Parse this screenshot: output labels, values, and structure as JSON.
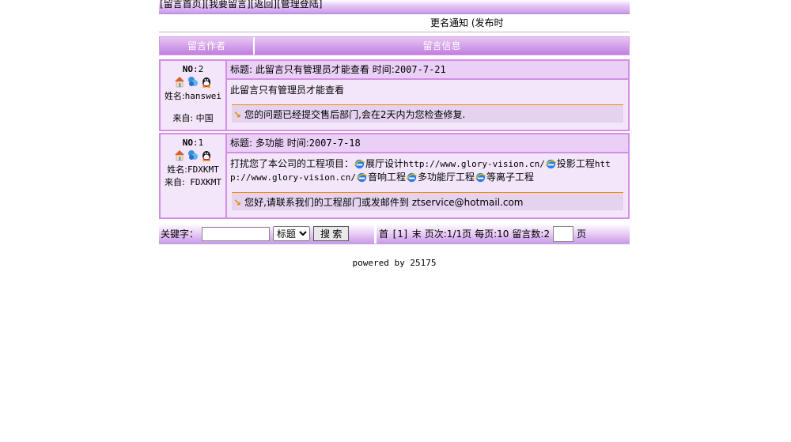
{
  "nav": {
    "items": [
      "[留言首页]",
      "[我要留言]",
      "[返回]",
      "[管理登陆]"
    ]
  },
  "notice": "更名通知 (发布时",
  "header": {
    "author": "留言作者",
    "info": "留言信息"
  },
  "messages": [
    {
      "no_label": "NO",
      "no": ":2",
      "name_label": "姓名:",
      "name": "hanswei",
      "from_label": "来自:",
      "from": " 中国",
      "title_label": "标题:",
      "title": " 此留言只有管理员才能查看",
      "time_label": " 时间:",
      "time": "2007-7-21",
      "content": "此留言只有管理员才能查看",
      "reply": "您的问题已经提交售后部门,会在2天内为您检查修复."
    },
    {
      "no_label": "NO",
      "no": ":1",
      "name_label": "姓名:",
      "name": "FDXKMT",
      "from_label": "来自:",
      "from": " FDXKMT",
      "title_label": "标题:",
      "title": " 多功能",
      "time_label": " 时间:",
      "time": "2007-7-18",
      "content_parts": {
        "intro": "打扰您了本公司的工程项目：",
        "l1": "展厅设计",
        "u1": "http://www.glory-vision.cn/",
        "l2": "投影工程",
        "u2": "http://www.glory-vision.cn/",
        "l3": "音响工程",
        "l4": "多功能厅工程",
        "l5": "等离子工程"
      },
      "reply": "您好,请联系我们的工程部门或发邮件到 ztservice@hotmail.com"
    }
  ],
  "search": {
    "keyword_label": "关键字：",
    "keyword_value": "",
    "field_selected": "标题",
    "button_label": "搜 索"
  },
  "pager": {
    "first": "首",
    "current": "[1]",
    "last": "末",
    "page_info": "页次:1/1页",
    "per_page": "每页:10",
    "count": "留言数:2",
    "goto_value": "",
    "page_suffix": "页"
  },
  "footer": "powered by 25175",
  "colors": {
    "accent": "#c07fe0",
    "border": "#d48fe4",
    "reply_line": "#f08a00"
  }
}
